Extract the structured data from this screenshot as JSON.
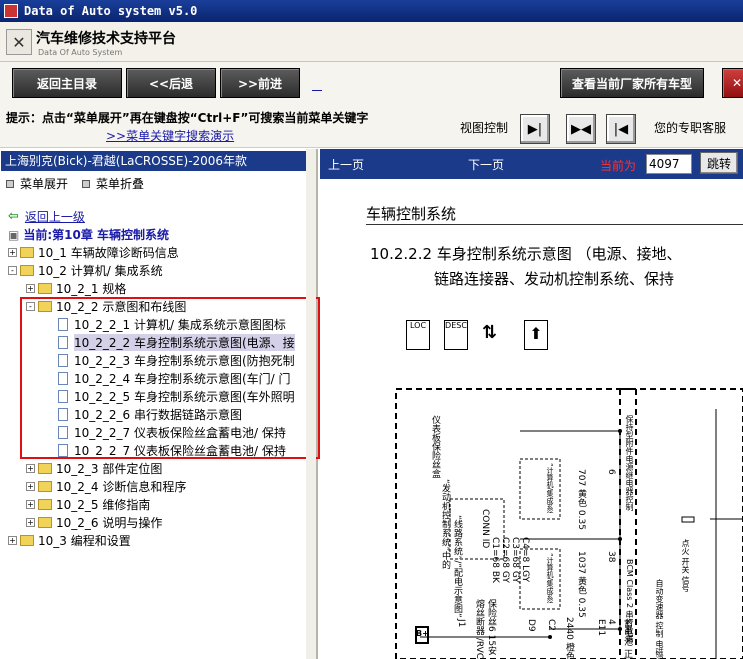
{
  "window": {
    "title": "Data of Auto system v5.0"
  },
  "brand": {
    "title": "汽车维修技术支持平台",
    "subtitle": "Data Of Auto System"
  },
  "nav": {
    "home": "返回主目录",
    "back": "<<后退",
    "forward": ">>前进",
    "all_models": "查看当前厂家所有车型"
  },
  "hint": {
    "text": "提示：点击“菜单展开”再在键盘按“Ctrl+F”可搜索当前菜单关键字",
    "link": ">>菜单关键字搜索演示",
    "view_label": "视图控制",
    "service": "您的专职客服"
  },
  "tree": {
    "model": "上海别克(Bick)-君越(LaCROSSE)-2006年款",
    "expand": "菜单展开",
    "collapse": "菜单折叠",
    "back_up": "返回上一级",
    "current": "当前:第10章  车辆控制系统",
    "nodes": [
      {
        "label": "10_1 车辆故障诊断码信息",
        "exp": "+"
      },
      {
        "label": "10_2 计算机/ 集成系统",
        "exp": "-"
      },
      {
        "label": "10_2_1 规格",
        "exp": "+"
      },
      {
        "label": "10_2_2 示意图和布线图",
        "exp": "-"
      },
      {
        "label": "10_2_2_1 计算机/ 集成系统示意图图标"
      },
      {
        "label": "10_2_2_2 车身控制系统示意图(电源、接"
      },
      {
        "label": "10_2_2_3 车身控制系统示意图(防抱死制"
      },
      {
        "label": "10_2_2_4 车身控制系统示意图(车门/ 门"
      },
      {
        "label": "10_2_2_5 车身控制系统示意图(车外照明"
      },
      {
        "label": "10_2_2_6 串行数据链路示意图"
      },
      {
        "label": "10_2_2_7 仪表板保险丝盒蓄电池/ 保持"
      },
      {
        "label": "10_2_2_7 仪表板保险丝盒蓄电池/ 保持"
      },
      {
        "label": "10_2_3 部件定位图",
        "exp": "+"
      },
      {
        "label": "10_2_4 诊断信息和程序",
        "exp": "+"
      },
      {
        "label": "10_2_5 维修指南",
        "exp": "+"
      },
      {
        "label": "10_2_6 说明与操作",
        "exp": "+"
      },
      {
        "label": "10_3 编程和设置",
        "exp": "+"
      }
    ]
  },
  "viewer": {
    "prev": "上一页",
    "next": "下一页",
    "current_label": "当前为",
    "page": "4097",
    "jump": "跳转",
    "heading": "车辆控制系统",
    "subheading_1": "10.2.2.2 车身控制系统示意图 （电源、接地、",
    "subheading_2": "链路连接器、发动机控制系统、保持",
    "diagram": {
      "icons": [
        "LOC",
        "DESC"
      ],
      "texts": [
        "仪表板保险丝盒",
        "“发动机控制系统”中的",
        "“线路系统”/“配电示意图”",
        "C1=68 BK",
        "C2=68 GY",
        "C3=68 GY",
        "C4=8 LGY",
        "CONN ID",
        "“计算机/集成系统”中的“数据链路连接器”示意图",
        "“计算机/集成系统”中的“串行数据链路示意图”",
        "保持型附件电源继电器控制",
        "BCM Class 2 串行数据",
        "707 黄色 0.35",
        "1037 黄色 0.35",
        "2440 橙色 0.8",
        "4",
        "6",
        "38",
        "D9",
        "C2",
        "J1",
        "E11",
        "D11",
        "保险丝6 15安",
        "熔丝断器 /RVC",
        "蓄电池 正极电压",
        "自动变速器 控制 电磁阀 电源",
        "点火 开关 信号",
        "B+"
      ]
    }
  }
}
